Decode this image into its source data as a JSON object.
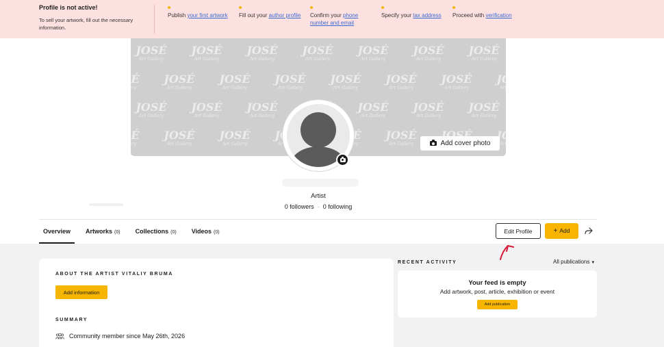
{
  "banner": {
    "title": "Profile is not active!",
    "description": "To sell your artwork, fill out the necessary information.",
    "steps": [
      {
        "prefix": "Publish ",
        "link": "your first artwork"
      },
      {
        "prefix": "Fill out your ",
        "link": "author profile"
      },
      {
        "prefix": "Confirm your ",
        "link": "phone number and email"
      },
      {
        "prefix": "Specify your ",
        "link": "tax address"
      },
      {
        "prefix": "Proceed with ",
        "link": "verification"
      }
    ],
    "dot_color": "#f5b400"
  },
  "cover": {
    "watermark_main": "JOSÉ",
    "watermark_sub": "Art Gallery",
    "add_cover_label": "Add cover photo"
  },
  "profile": {
    "role": "Artist",
    "followers": "0 followers",
    "separator": "·",
    "following": "0 following"
  },
  "tabs": [
    {
      "label": "Overview",
      "count": ""
    },
    {
      "label": "Artworks",
      "count": "(0)"
    },
    {
      "label": "Collections",
      "count": "(0)"
    },
    {
      "label": "Videos",
      "count": "(0)"
    }
  ],
  "actions": {
    "edit_label": "Edit Profile",
    "add_plus": "+",
    "add_label": "Add"
  },
  "about": {
    "heading": "ABOUT THE ARTIST VITALIY BRUMA",
    "add_info_label": "Add information",
    "summary_heading": "SUMMARY",
    "member_since": "Community member since May 26th, 2026"
  },
  "recent": {
    "heading": "RECENT ACTIVITY",
    "filter_label": "All publications",
    "filter_caret": "▼",
    "empty_title": "Your feed is empty",
    "empty_sub": "Add artwork, post, article, exhibition or event",
    "add_pub_label": "Add publication"
  },
  "colors": {
    "accent": "#f7b500",
    "banner_bg": "#fde1e1",
    "link": "#3d6bd1",
    "annotation": "#d81b3a"
  }
}
